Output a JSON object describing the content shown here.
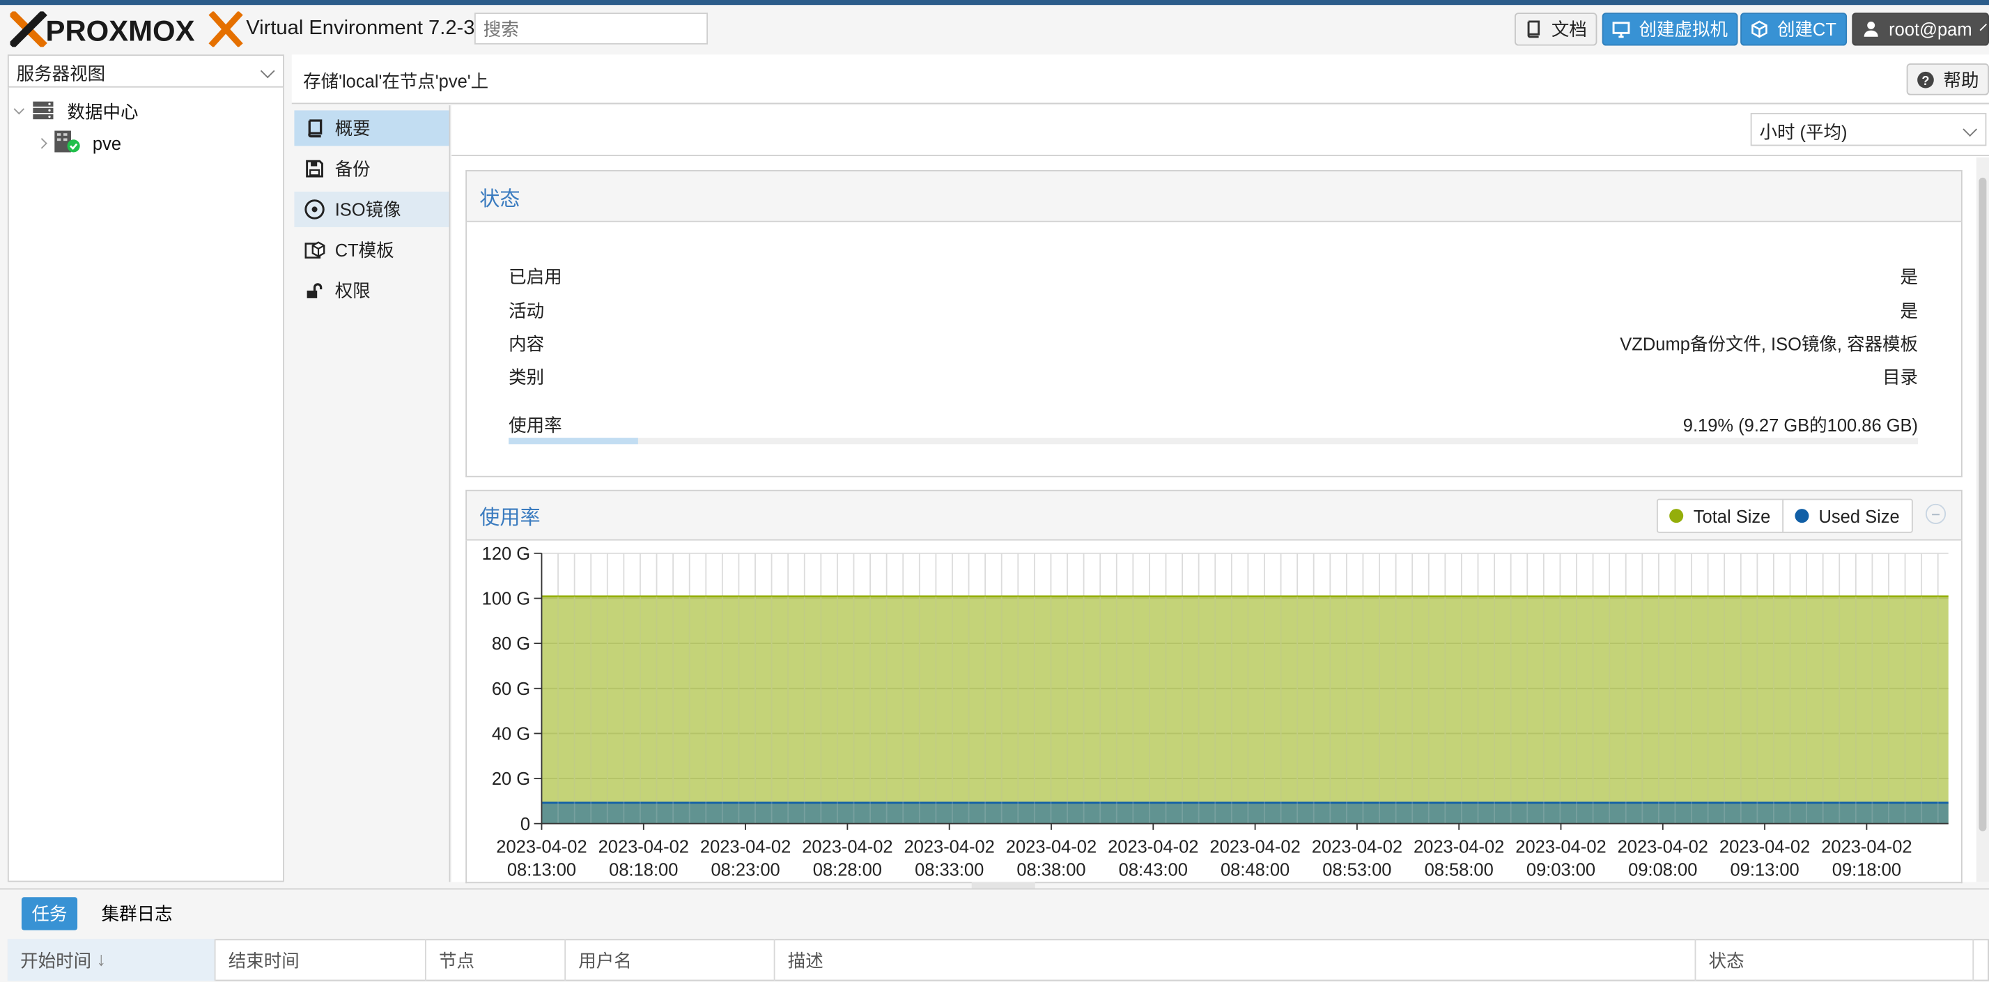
{
  "app": {
    "logo_text": "PROXMOX",
    "version": "Virtual Environment 7.2-3",
    "search_placeholder": "搜索",
    "docs_label": "文档",
    "create_vm_label": "创建虚拟机",
    "create_ct_label": "创建CT",
    "user_label": "root@pam"
  },
  "sidebar": {
    "view_select": "服务器视图",
    "tree": [
      {
        "label": "数据中心"
      },
      {
        "label": "pve"
      }
    ]
  },
  "content": {
    "breadcrumb": "存储'local'在节点'pve'上",
    "help_label": "帮助",
    "nav": [
      {
        "label": "概要",
        "selected": true
      },
      {
        "label": "备份"
      },
      {
        "label": "ISO镜像"
      },
      {
        "label": "CT模板"
      },
      {
        "label": "权限"
      }
    ],
    "timeframe": "小时 (平均)",
    "status_panel": {
      "title": "状态",
      "rows": [
        {
          "label": "已启用",
          "value": "是"
        },
        {
          "label": "活动",
          "value": "是"
        },
        {
          "label": "内容",
          "value": "VZDump备份文件, ISO镜像, 容器模板"
        },
        {
          "label": "类别",
          "value": "目录"
        }
      ],
      "usage_label": "使用率",
      "usage_value": "9.19% (9.27 GB的100.86 GB)",
      "usage_fraction": 0.0919
    },
    "usage_panel": {
      "title": "使用率",
      "legend": [
        {
          "name": "Total Size",
          "color": "#94ae0a"
        },
        {
          "name": "Used Size",
          "color": "#115fa6"
        }
      ]
    }
  },
  "chart_data": {
    "type": "area",
    "title": "使用率",
    "y_ticks": [
      "0",
      "20 G",
      "40 G",
      "60 G",
      "80 G",
      "100 G",
      "120 G"
    ],
    "ylim": [
      0,
      120
    ],
    "y_unit": "G",
    "x_ticks": [
      [
        "2023-04-02",
        "08:13:00"
      ],
      [
        "2023-04-02",
        "08:18:00"
      ],
      [
        "2023-04-02",
        "08:23:00"
      ],
      [
        "2023-04-02",
        "08:28:00"
      ],
      [
        "2023-04-02",
        "08:33:00"
      ],
      [
        "2023-04-02",
        "08:38:00"
      ],
      [
        "2023-04-02",
        "08:43:00"
      ],
      [
        "2023-04-02",
        "08:48:00"
      ],
      [
        "2023-04-02",
        "08:53:00"
      ],
      [
        "2023-04-02",
        "08:58:00"
      ],
      [
        "2023-04-02",
        "09:03:00"
      ],
      [
        "2023-04-02",
        "09:08:00"
      ],
      [
        "2023-04-02",
        "09:13:00"
      ],
      [
        "2023-04-02",
        "09:18:00"
      ]
    ],
    "series": [
      {
        "name": "Total Size",
        "color": "#94ae0a",
        "value": 100.86
      },
      {
        "name": "Used Size",
        "color": "#115fa6",
        "value": 9.27
      }
    ],
    "grid": true,
    "legend_position": "top-right"
  },
  "bottom": {
    "tabs": [
      {
        "label": "任务",
        "selected": true
      },
      {
        "label": "集群日志"
      }
    ],
    "columns": [
      "开始时间",
      "结束时间",
      "节点",
      "用户名",
      "描述",
      "状态"
    ]
  }
}
